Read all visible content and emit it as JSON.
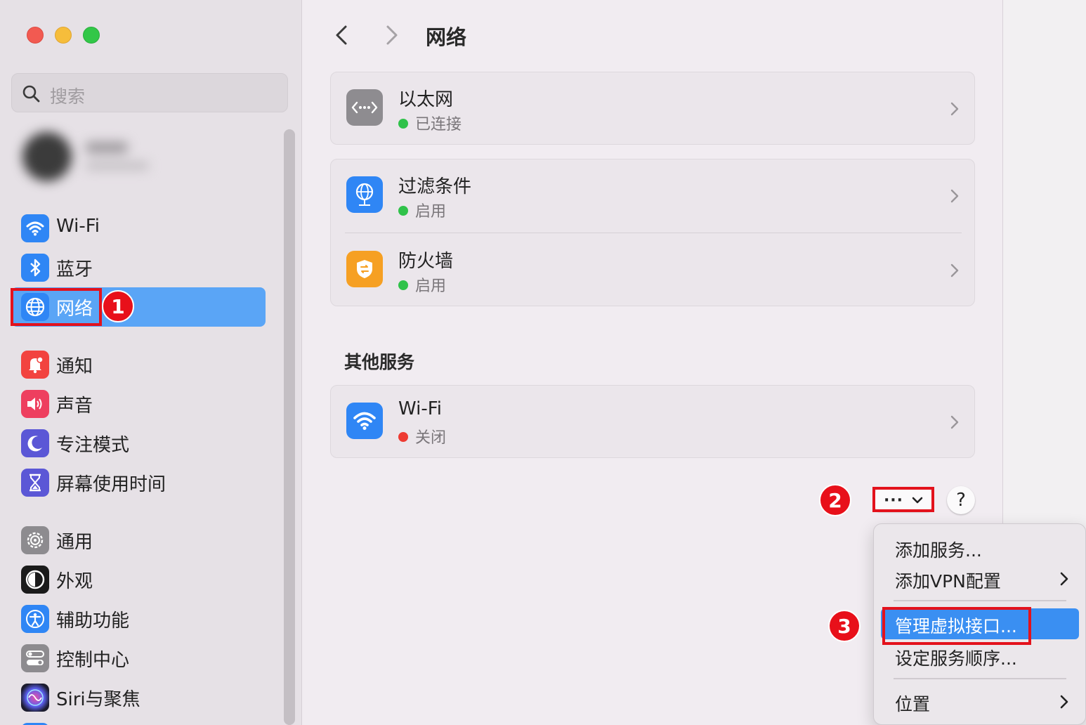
{
  "sidebar": {
    "search_placeholder": "搜索",
    "items_group1": [
      {
        "label": "Wi-Fi",
        "icon": "wifi-icon",
        "color": "#2f86f5"
      },
      {
        "label": "蓝牙",
        "icon": "bluetooth-icon",
        "color": "#2f86f5"
      },
      {
        "label": "网络",
        "icon": "globe-icon",
        "color": "#2f86f5",
        "selected": true
      }
    ],
    "items_group2": [
      {
        "label": "通知",
        "icon": "bell-icon",
        "color": "#f2433f"
      },
      {
        "label": "声音",
        "icon": "speaker-icon",
        "color": "#ee3f5f"
      },
      {
        "label": "专注模式",
        "icon": "moon-icon",
        "color": "#5b57d6"
      },
      {
        "label": "屏幕使用时间",
        "icon": "hourglass-icon",
        "color": "#5b57d6"
      }
    ],
    "items_group3": [
      {
        "label": "通用",
        "icon": "gear-icon",
        "color": "#8d8b8f"
      },
      {
        "label": "外观",
        "icon": "appearance-icon",
        "color": "#1a1a1a"
      },
      {
        "label": "辅助功能",
        "icon": "accessibility-icon",
        "color": "#2f86f5"
      },
      {
        "label": "控制中心",
        "icon": "toggle-icon",
        "color": "#8d8b8f"
      },
      {
        "label": "Siri与聚焦",
        "icon": "siri-icon",
        "color": "#1c1c2e"
      }
    ]
  },
  "header": {
    "title": "网络"
  },
  "services": {
    "ethernet": {
      "name": "以太网",
      "status": "已连接",
      "status_color": "#30c24a"
    },
    "filter": {
      "name": "过滤条件",
      "status": "启用",
      "status_color": "#30c24a"
    },
    "firewall": {
      "name": "防火墙",
      "status": "启用",
      "status_color": "#30c24a"
    }
  },
  "other_services": {
    "title": "其他服务",
    "wifi": {
      "name": "Wi-Fi",
      "status": "关闭",
      "status_color": "#ee3b32"
    }
  },
  "toolbar": {
    "more_label": "···",
    "help_label": "?"
  },
  "menu": {
    "items": [
      "添加服务...",
      "添加VPN配置",
      "管理虚拟接口...",
      "设定服务顺序...",
      "位置"
    ]
  },
  "annotations": {
    "step1": "1",
    "step2": "2",
    "step3": "3"
  }
}
